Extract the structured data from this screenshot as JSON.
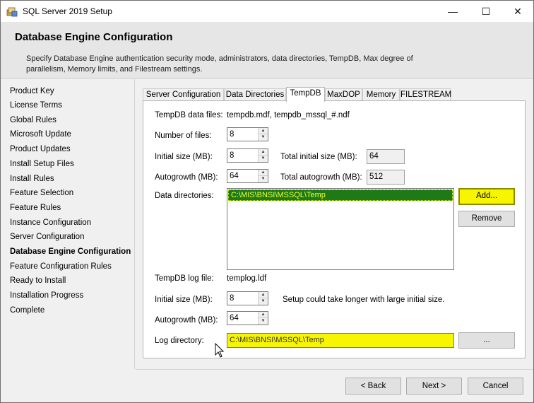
{
  "window": {
    "title": "SQL Server 2019 Setup",
    "controls": {
      "minimize": "—",
      "maximize": "☐",
      "close": "✕"
    }
  },
  "header": {
    "title": "Database Engine Configuration",
    "description": "Specify Database Engine authentication security mode, administrators, data directories, TempDB, Max degree of parallelism, Memory limits, and Filestream settings."
  },
  "nav": {
    "items": [
      {
        "label": "Product Key"
      },
      {
        "label": "License Terms"
      },
      {
        "label": "Global Rules"
      },
      {
        "label": "Microsoft Update"
      },
      {
        "label": "Product Updates"
      },
      {
        "label": "Install Setup Files"
      },
      {
        "label": "Install Rules"
      },
      {
        "label": "Feature Selection"
      },
      {
        "label": "Feature Rules"
      },
      {
        "label": "Instance Configuration"
      },
      {
        "label": "Server Configuration"
      },
      {
        "label": "Database Engine Configuration"
      },
      {
        "label": "Feature Configuration Rules"
      },
      {
        "label": "Ready to Install"
      },
      {
        "label": "Installation Progress"
      },
      {
        "label": "Complete"
      }
    ],
    "active": "Database Engine Configuration"
  },
  "tabs": [
    {
      "label": "Server Configuration"
    },
    {
      "label": "Data Directories"
    },
    {
      "label": "TempDB"
    },
    {
      "label": "MaxDOP"
    },
    {
      "label": "Memory"
    },
    {
      "label": "FILESTREAM"
    }
  ],
  "selected_tab": "TempDB",
  "tempdb": {
    "data_files_label": "TempDB data files:",
    "data_files_value": "tempdb.mdf, tempdb_mssql_#.ndf",
    "num_files_label": "Number of files:",
    "num_files_value": "8",
    "initial_size_label": "Initial size (MB):",
    "initial_size_value": "8",
    "total_initial_label": "Total initial size (MB):",
    "total_initial_value": "64",
    "autogrowth_label": "Autogrowth (MB):",
    "autogrowth_value": "64",
    "total_autogrowth_label": "Total autogrowth (MB):",
    "total_autogrowth_value": "512",
    "data_dirs_label": "Data directories:",
    "data_dirs": [
      "C:\\MIS\\BNSI\\MSSQL\\Temp"
    ],
    "add_button": "Add...",
    "remove_button": "Remove",
    "log_file_label": "TempDB log file:",
    "log_file_value": "templog.ldf",
    "log_initial_label": "Initial size (MB):",
    "log_initial_value": "8",
    "log_warning": "Setup could take longer with large initial size.",
    "log_autogrowth_label": "Autogrowth (MB):",
    "log_autogrowth_value": "64",
    "log_dir_label": "Log directory:",
    "log_dir_value": "C:\\MIS\\BNSI\\MSSQL\\Temp",
    "browse_button": "..."
  },
  "footer": {
    "back": "< Back",
    "next": "Next >",
    "cancel": "Cancel"
  },
  "colors": {
    "highlight_yellow": "#f8f500",
    "selection_green": "#1d7a17",
    "selection_text": "#f0ff3a"
  }
}
